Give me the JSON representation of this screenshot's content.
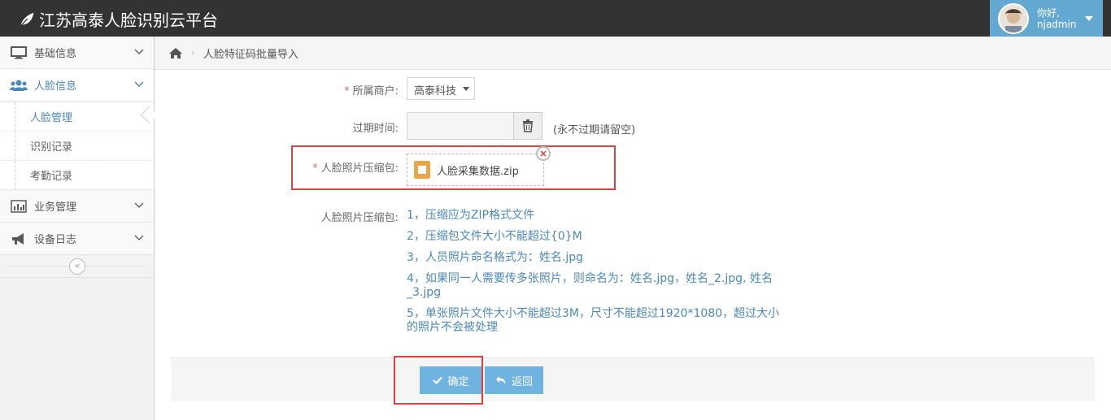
{
  "app": {
    "title": "江苏高泰人脸识别云平台"
  },
  "user": {
    "greeting": "你好,",
    "name": "njadmin"
  },
  "sidebar": {
    "items": [
      {
        "label": "基础信息",
        "icon": "desktop-icon"
      },
      {
        "label": "人脸信息",
        "icon": "users-icon"
      },
      {
        "label": "业务管理",
        "icon": "bar-chart-icon"
      },
      {
        "label": "设备日志",
        "icon": "bullhorn-icon"
      }
    ],
    "submenu": [
      {
        "label": "人脸管理",
        "active": true
      },
      {
        "label": "识别记录",
        "active": false
      },
      {
        "label": "考勤记录",
        "active": false
      }
    ],
    "collapse_symbol": "«"
  },
  "breadcrumb": {
    "current": "人脸特征码批量导入"
  },
  "form": {
    "merchant_label": "所属商户:",
    "merchant_value": "高泰科技",
    "expire_label": "过期时间:",
    "expire_hint": "(永不过期请留空)",
    "package_label": "人脸照片压缩包:",
    "file_name": "人脸采集数据.zip",
    "rules_label": "人脸照片压缩包:",
    "rules": [
      "1，压缩应为ZIP格式文件",
      "2，压缩包文件大小不能超过{0}M",
      "3，人员照片命名格式为：姓名.jpg",
      "4，如果同一人需要传多张照片，则命名为：姓名.jpg，姓名_2.jpg, 姓名_3.jpg",
      "5，单张照片文件大小不能超过3M，尺寸不能超过1920*1080，超过大小的照片不会被处理"
    ]
  },
  "actions": {
    "confirm": "确定",
    "back": "返回"
  },
  "colors": {
    "navbar": "#333333",
    "accent": "#62a8d1",
    "link_blue": "#4b88b7",
    "highlight_red": "#e0403f"
  }
}
